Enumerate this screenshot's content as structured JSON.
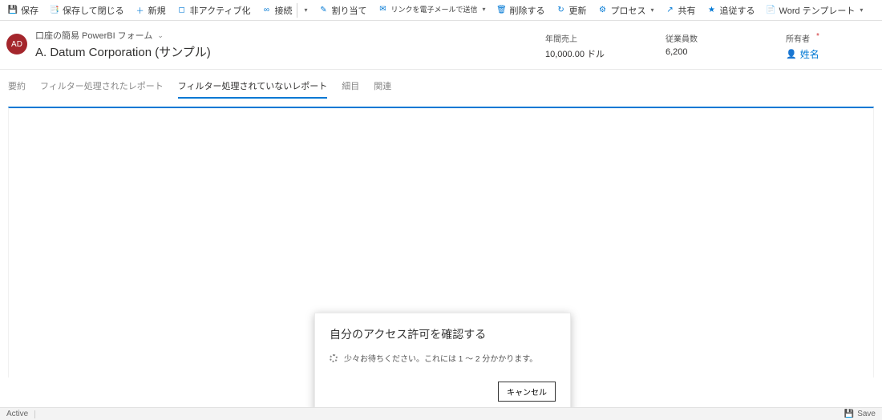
{
  "commandBar": {
    "save": "保存",
    "saveClose": "保存して閉じる",
    "new": "新規",
    "deactivate": "非アクティブ化",
    "connect": "接続",
    "assign": "割り当て",
    "emailLink": "リンクを電子メールで送信",
    "delete": "削除する",
    "refresh": "更新",
    "process": "プロセス",
    "share": "共有",
    "follow": "追従する",
    "wordTemplates": "Word テンプレート"
  },
  "header": {
    "initials": "AD",
    "formName": "口座の簡易 PowerBI フォーム",
    "recordTitle": "A. Datum Corporation (サンプル)",
    "annualRevenueLabel": "年間売上",
    "annualRevenueValue": "10,000.00 ドル",
    "employeesLabel": "従業員数",
    "employeesValue": "6,200",
    "ownerLabel": "所有者",
    "ownerValue": "姓名"
  },
  "tabs": {
    "summary": "要約",
    "filteredReport": "フィルター処理されたレポート",
    "unfilteredReport": "フィルター処理されていないレポート",
    "details": "細目",
    "related": "関連"
  },
  "dialog": {
    "title": "自分のアクセス許可を確認する",
    "body": "少々お待ちください。これには 1 ～ 2 分かかります。",
    "cancel": "キャンセル"
  },
  "footer": {
    "status": "Active",
    "save": "Save"
  }
}
